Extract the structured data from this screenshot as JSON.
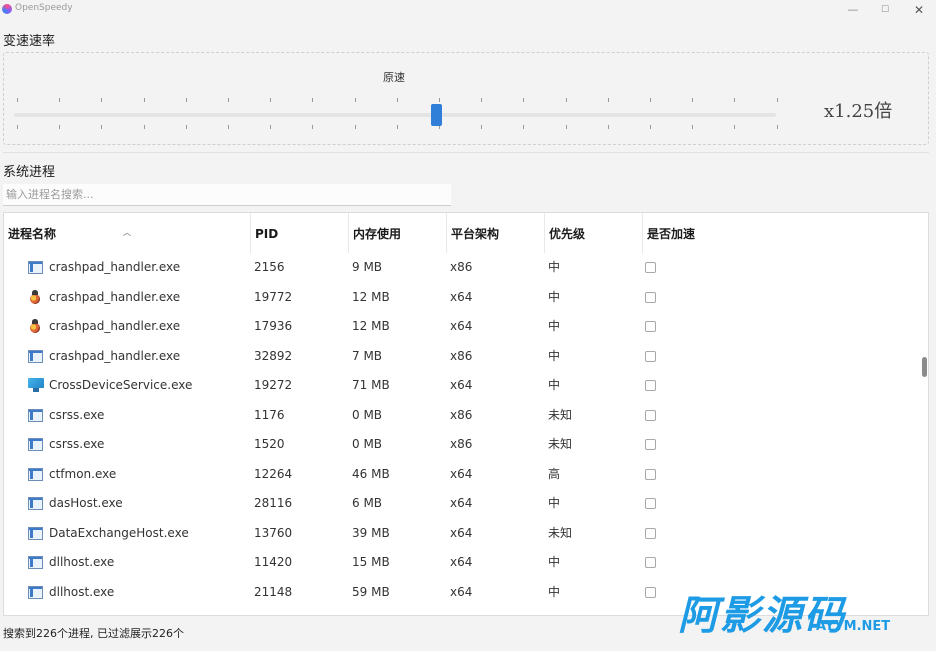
{
  "window": {
    "title": "OpenSpeedy",
    "minimize": "—",
    "maximize": "☐",
    "close": "✕"
  },
  "speed": {
    "section_title": "变速速率",
    "slider_label": "原速",
    "value_text": "x1.25倍",
    "level_fraction": 0.55
  },
  "processes": {
    "section_title": "系统进程",
    "search_placeholder": "输入进程名搜索...",
    "columns": [
      "进程名称",
      "PID",
      "内存使用",
      "平台架构",
      "优先级",
      "是否加速"
    ],
    "rows": [
      {
        "icon": "app-window-icon",
        "name": "crashpad_handler.exe",
        "pid": "2156",
        "mem": "9 MB",
        "arch": "x86",
        "priority": "中"
      },
      {
        "icon": "bug-icon",
        "name": "crashpad_handler.exe",
        "pid": "19772",
        "mem": "12 MB",
        "arch": "x64",
        "priority": "中"
      },
      {
        "icon": "bug-icon",
        "name": "crashpad_handler.exe",
        "pid": "17936",
        "mem": "12 MB",
        "arch": "x64",
        "priority": "中"
      },
      {
        "icon": "app-window-icon",
        "name": "crashpad_handler.exe",
        "pid": "32892",
        "mem": "7 MB",
        "arch": "x86",
        "priority": "中"
      },
      {
        "icon": "monitor-icon",
        "name": "CrossDeviceService.exe",
        "pid": "19272",
        "mem": "71 MB",
        "arch": "x64",
        "priority": "中"
      },
      {
        "icon": "app-window-icon",
        "name": "csrss.exe",
        "pid": "1176",
        "mem": "0 MB",
        "arch": "x86",
        "priority": "未知"
      },
      {
        "icon": "app-window-icon",
        "name": "csrss.exe",
        "pid": "1520",
        "mem": "0 MB",
        "arch": "x86",
        "priority": "未知"
      },
      {
        "icon": "app-window-icon",
        "name": "ctfmon.exe",
        "pid": "12264",
        "mem": "46 MB",
        "arch": "x64",
        "priority": "高"
      },
      {
        "icon": "app-window-icon",
        "name": "dasHost.exe",
        "pid": "28116",
        "mem": "6 MB",
        "arch": "x64",
        "priority": "中"
      },
      {
        "icon": "app-window-icon",
        "name": "DataExchangeHost.exe",
        "pid": "13760",
        "mem": "39 MB",
        "arch": "x64",
        "priority": "未知"
      },
      {
        "icon": "app-window-icon",
        "name": "dllhost.exe",
        "pid": "11420",
        "mem": "15 MB",
        "arch": "x64",
        "priority": "中"
      },
      {
        "icon": "app-window-icon",
        "name": "dllhost.exe",
        "pid": "21148",
        "mem": "59 MB",
        "arch": "x64",
        "priority": "中"
      }
    ],
    "status_text": "搜索到226个进程, 已过滤展示226个"
  },
  "watermark": {
    "main": "阿影源码",
    "sub": "AYYM.NET"
  }
}
